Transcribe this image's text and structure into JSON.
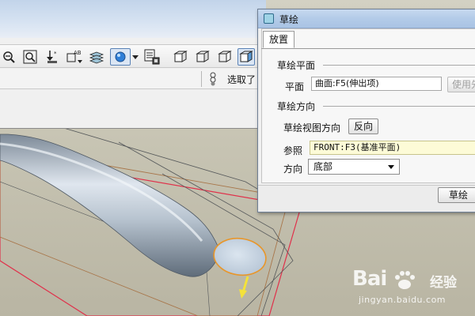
{
  "toolbar": {
    "icons": [
      "zoom-out-icon",
      "zoom-fit-icon",
      "datum-point-icon",
      "axis-text-icon",
      "layers-icon",
      "display-style-icon",
      "dropdown-arrow-icon",
      "model-tree-icon",
      "view-front-icon",
      "view-top-icon",
      "view-right-icon",
      "view-iso-icon"
    ],
    "filter_label": "选取了"
  },
  "dialog": {
    "title": "草绘",
    "tab_placement": "放置",
    "sketch_plane": {
      "header": "草绘平面",
      "plane_label": "平面",
      "plane_value": "曲面:F5(伸出项)",
      "use_previous_button": "使用先"
    },
    "sketch_orientation": {
      "header": "草绘方向",
      "view_direction_label": "草绘视图方向",
      "flip_button": "反向",
      "reference_label": "参照",
      "reference_value": "FRONT:F3(基准平面)",
      "direction_label": "方向",
      "direction_value": "底部"
    },
    "sketch_button": "草绘"
  },
  "watermark": {
    "brand": "Bai",
    "brand2": "经验",
    "url": "jingyan.baidu.com"
  },
  "colors": {
    "viewport_bg": "#c9c5b5",
    "tube": "#a9b5c2",
    "datum_red": "#e0304a",
    "highlight_orange": "#e8962a",
    "dialog_title": "#b3cbe8",
    "reference_field": "#fdfbd7"
  }
}
